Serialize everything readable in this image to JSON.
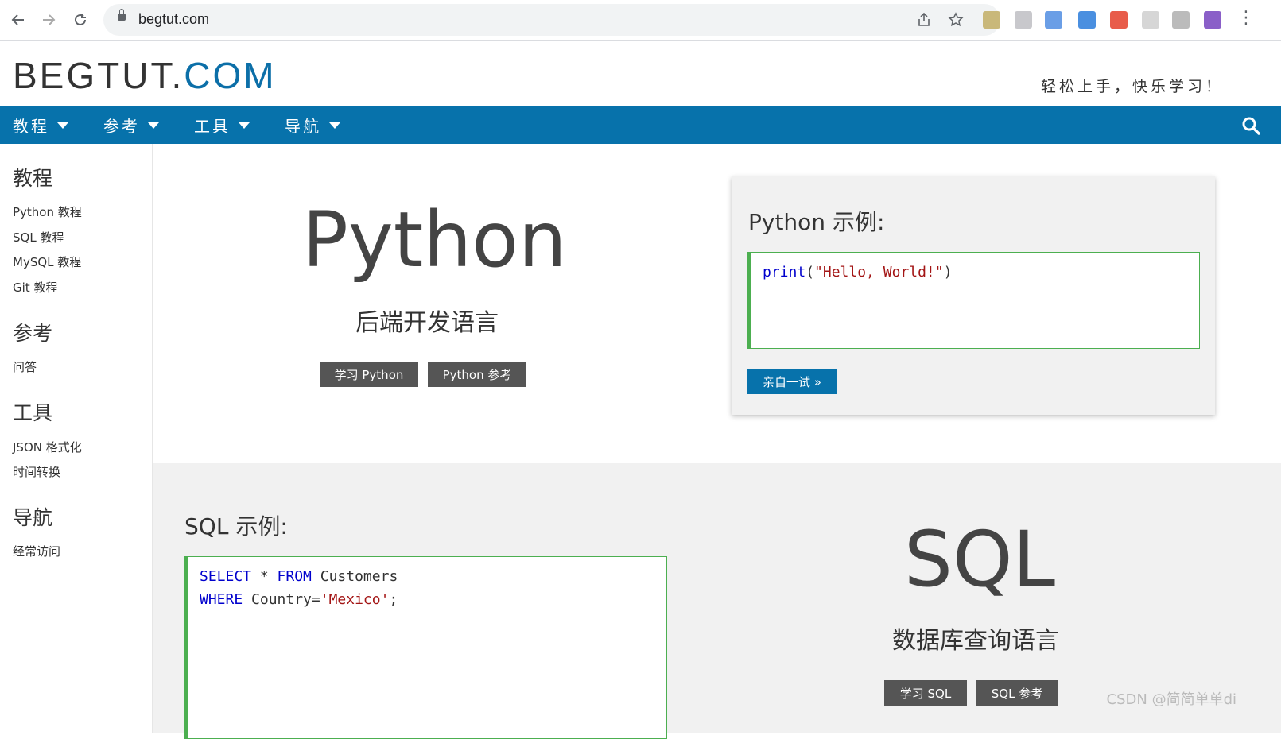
{
  "browser": {
    "url": "begtut.com",
    "back_icon": "arrow-left-icon",
    "forward_icon": "arrow-right-icon",
    "reload_icon": "reload-icon",
    "share_icon": "share-icon",
    "star_icon": "star-icon"
  },
  "header": {
    "logo_part1": "BEGTUT.",
    "logo_part2": "COM",
    "slogan": "轻松上手，快乐学习！",
    "accent_color": "#0772ab"
  },
  "topnav": {
    "items": [
      {
        "label": "教程"
      },
      {
        "label": "参考"
      },
      {
        "label": "工具"
      },
      {
        "label": "导航"
      }
    ],
    "search_icon": "search-icon"
  },
  "sidebar": {
    "sections": [
      {
        "heading": "教程",
        "links": [
          "Python 教程",
          "SQL 教程",
          "MySQL 教程",
          "Git 教程"
        ]
      },
      {
        "heading": "参考",
        "links": [
          "问答"
        ]
      },
      {
        "heading": "工具",
        "links": [
          "JSON 格式化",
          "时间转换"
        ]
      },
      {
        "heading": "导航",
        "links": [
          "经常访问"
        ]
      }
    ]
  },
  "python_section": {
    "title": "Python",
    "subtitle": "后端开发语言",
    "btn_learn": "学习 Python",
    "btn_ref": "Python 参考",
    "example_title": "Python 示例:",
    "code_func": "print",
    "code_open": "(",
    "code_str": "\"Hello, World!\"",
    "code_close": ")",
    "try_btn": "亲自一试 »"
  },
  "sql_section": {
    "example_title": "SQL 示例:",
    "code": {
      "kw_select": "SELECT",
      "star": " * ",
      "kw_from": "FROM",
      "table": " Customers",
      "kw_where": "WHERE",
      "cond": " Country=",
      "str": "'Mexico'",
      "semi": ";"
    },
    "title": "SQL",
    "subtitle": "数据库查询语言",
    "btn_learn": "学习 SQL",
    "btn_ref": "SQL 参考"
  },
  "watermark": "CSDN @简简单单di"
}
